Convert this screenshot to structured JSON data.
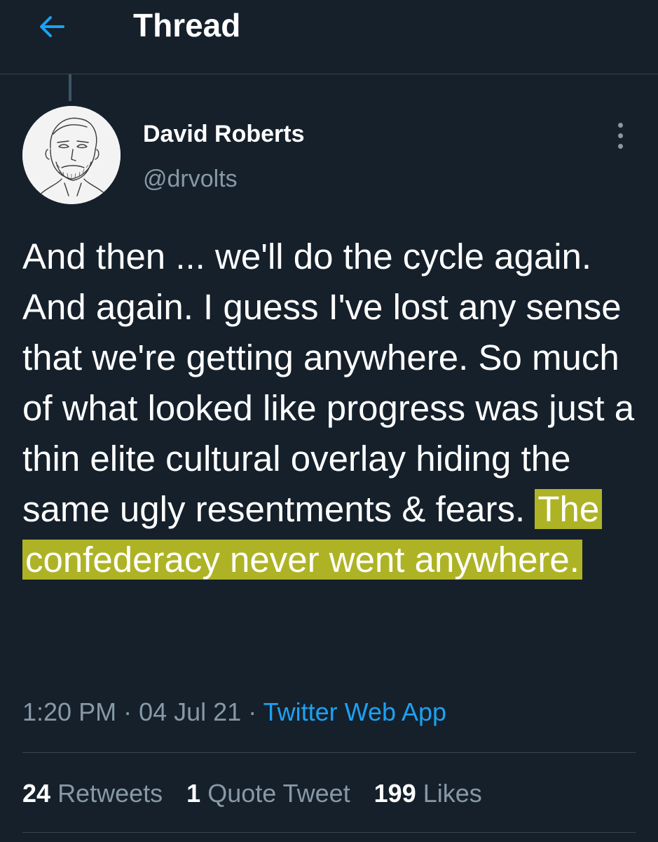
{
  "colors": {
    "background": "#15202b",
    "accent": "#1da1f2",
    "secondary_text": "#8899a6",
    "highlight": "#d1d424"
  },
  "header": {
    "back_icon": "arrow-left-icon",
    "title": "Thread"
  },
  "tweet": {
    "author": {
      "name": "David Roberts",
      "handle": "@drvolts"
    },
    "more_icon": "more-vertical-icon",
    "text_plain": "And then ... we'll do the cycle again. And again. I guess I've lost any sense that we're getting anywhere. So much of what looked like progress was just a thin elite cultural overlay hiding the same ugly resentments & fears.",
    "text_highlighted": "The confederacy never went anywhere.",
    "time": "1:20 PM",
    "date": "04 Jul 21",
    "separator": "·",
    "source": "Twitter Web App"
  },
  "stats": {
    "retweets_count": "24",
    "retweets_label": "Retweets",
    "quotes_count": "1",
    "quotes_label": "Quote Tweet",
    "likes_count": "199",
    "likes_label": "Likes"
  }
}
